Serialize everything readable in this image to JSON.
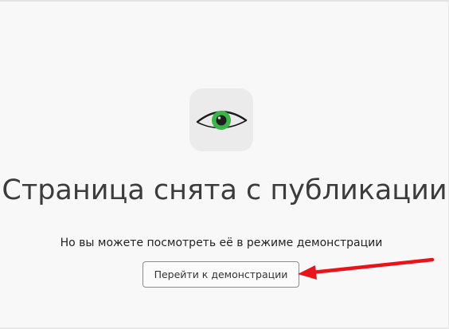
{
  "page": {
    "title": "Страница снята с публикации",
    "message": "Но вы можете посмотреть её в режиме демонстрации",
    "demo_button_label": "Перейти к демонстрации"
  },
  "icon": {
    "name": "eye-icon",
    "iris_color": "#3ab54a",
    "pupil_color": "#1e1e1e"
  },
  "annotation": {
    "name": "red-arrow",
    "color": "#e8141a"
  }
}
